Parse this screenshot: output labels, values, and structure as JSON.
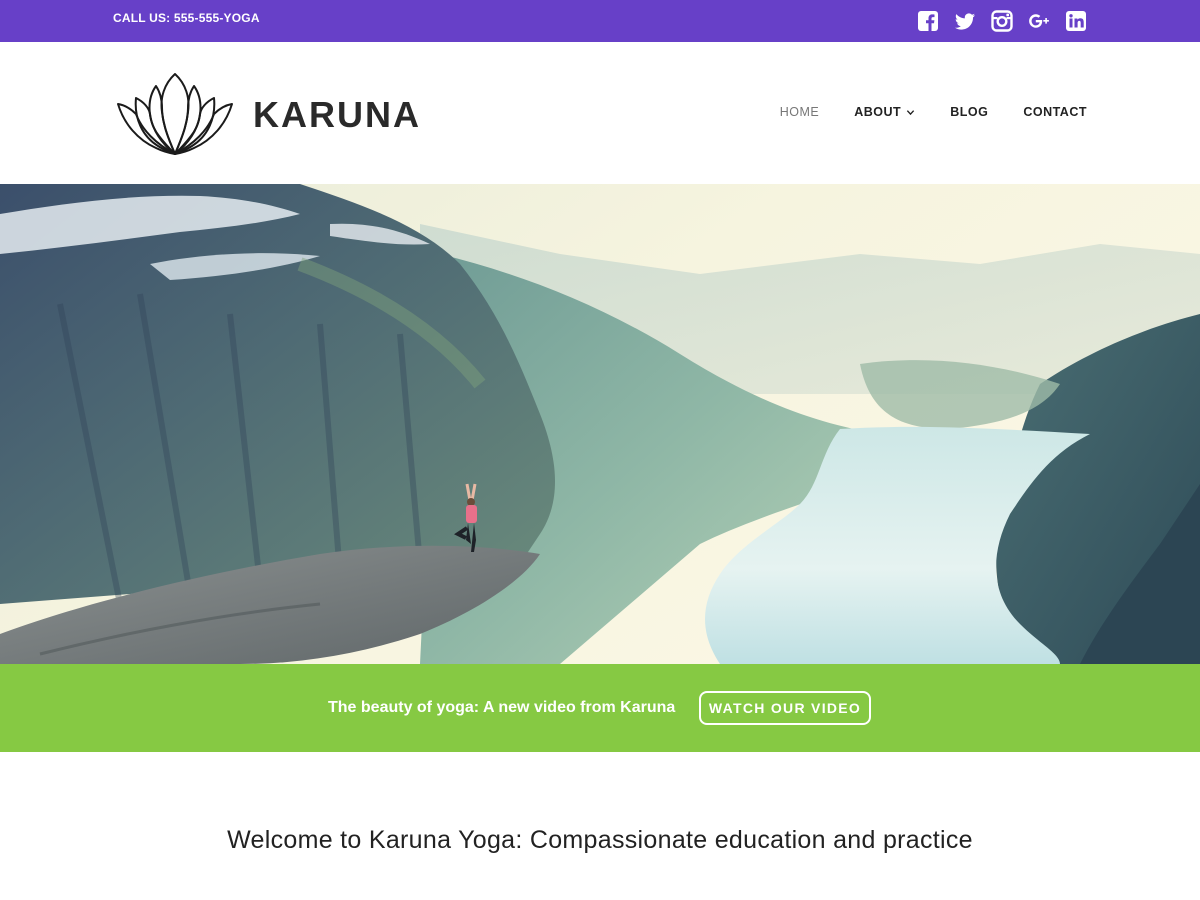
{
  "topbar": {
    "call": "CALL US: 555-555-YOGA",
    "bg_color": "#6740c8",
    "social": [
      {
        "name": "facebook-icon"
      },
      {
        "name": "twitter-icon"
      },
      {
        "name": "instagram-icon"
      },
      {
        "name": "google-plus-icon"
      },
      {
        "name": "linkedin-icon"
      }
    ]
  },
  "header": {
    "brand": "KARUNA",
    "logo": "lotus-logo",
    "nav": [
      {
        "label": "HOME",
        "active": true
      },
      {
        "label": "ABOUT",
        "dropdown": true
      },
      {
        "label": "BLOG"
      },
      {
        "label": "CONTACT"
      }
    ]
  },
  "hero": {
    "image": "mountain-fjord-yoga-pose"
  },
  "cta": {
    "text": "The beauty of yoga: A new video from Karuna",
    "button": "WATCH OUR VIDEO",
    "bg_color": "#86c943"
  },
  "welcome": {
    "heading": "Welcome to Karuna Yoga: Compassionate education and practice"
  }
}
